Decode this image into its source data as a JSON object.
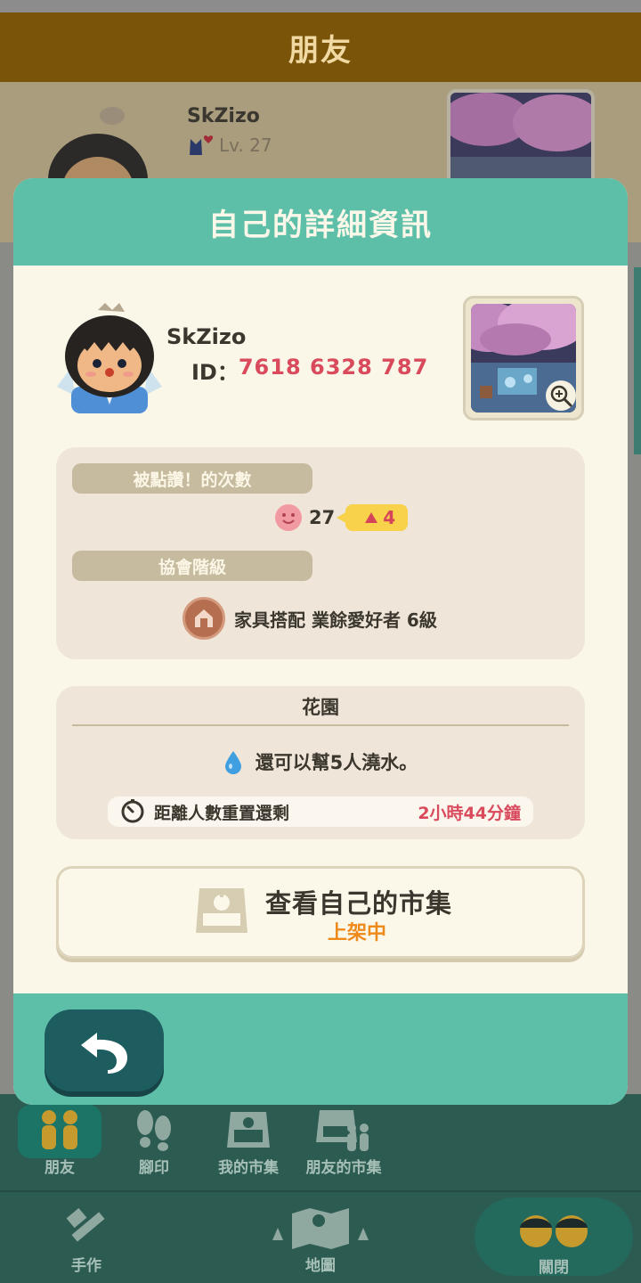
{
  "background": {
    "header_title": "朋友",
    "friend": {
      "name": "SkZizo",
      "level": "Lv. 27"
    }
  },
  "modal": {
    "title": "自己的詳細資訊",
    "user": {
      "name": "SkZizo",
      "id_label": "ID：",
      "id_value": "7618 6328 787"
    },
    "likes": {
      "label": "被點讚！的次數",
      "count": "27",
      "delta": "4"
    },
    "rank": {
      "label": "協會階級",
      "value": "家具搭配 業餘愛好者 6級"
    },
    "garden": {
      "title": "花園",
      "water_text": "還可以幫5人澆水。",
      "reset_label": "距離人數重置還剩",
      "reset_value": "2小時44分鐘"
    },
    "market": {
      "title": "查看自己的市集",
      "status": "上架中"
    }
  },
  "bottom_nav": {
    "row1": [
      "朋友",
      "腳印",
      "我的市集",
      "朋友的市集"
    ],
    "row2": [
      "手作",
      "地圖",
      "關閉"
    ]
  },
  "colors": {
    "accent_teal": "#5ebfa9",
    "modal_bg": "#faf6e8",
    "id_red": "#d84a5c",
    "status_orange": "#ee8a1a",
    "badge_yellow": "#f8d24a"
  }
}
